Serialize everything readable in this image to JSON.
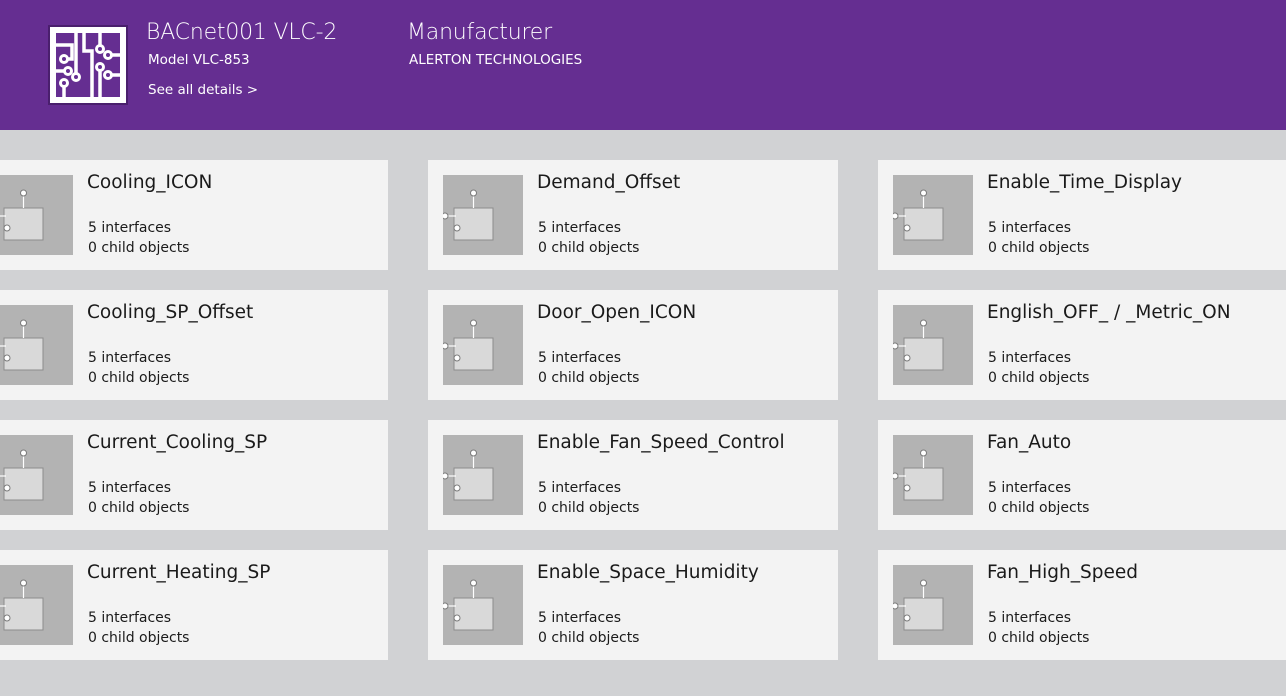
{
  "header": {
    "device_name": "BACnet001 VLC-2",
    "model": "Model VLC-853",
    "details_link": "See all details >",
    "manufacturer_heading": "Manufacturer",
    "manufacturer_value": "ALERTON TECHNOLOGIES",
    "background_color": "#652e91",
    "logo_icon": "circuit-board-icon"
  },
  "tile_icon": "module-node-icon",
  "tiles": [
    {
      "name": "Cooling_ICON",
      "interfaces": "5 interfaces",
      "children": "0 child objects"
    },
    {
      "name": "Demand_Offset",
      "interfaces": "5 interfaces",
      "children": "0 child objects"
    },
    {
      "name": "Enable_Time_Display",
      "interfaces": "5 interfaces",
      "children": "0 child objects"
    },
    {
      "name": "Cooling_SP_Offset",
      "interfaces": "5 interfaces",
      "children": "0 child objects"
    },
    {
      "name": "Door_Open_ICON",
      "interfaces": "5 interfaces",
      "children": "0 child objects"
    },
    {
      "name": "English_OFF_ / _Metric_ON",
      "interfaces": "5 interfaces",
      "children": "0 child objects"
    },
    {
      "name": "Current_Cooling_SP",
      "interfaces": "5 interfaces",
      "children": "0 child objects"
    },
    {
      "name": "Enable_Fan_Speed_Control",
      "interfaces": "5 interfaces",
      "children": "0 child objects"
    },
    {
      "name": "Fan_Auto",
      "interfaces": "5 interfaces",
      "children": "0 child objects"
    },
    {
      "name": "Current_Heating_SP",
      "interfaces": "5 interfaces",
      "children": "0 child objects"
    },
    {
      "name": "Enable_Space_Humidity",
      "interfaces": "5 interfaces",
      "children": "0 child objects"
    },
    {
      "name": "Fan_High_Speed",
      "interfaces": "5 interfaces",
      "children": "0 child objects"
    }
  ]
}
